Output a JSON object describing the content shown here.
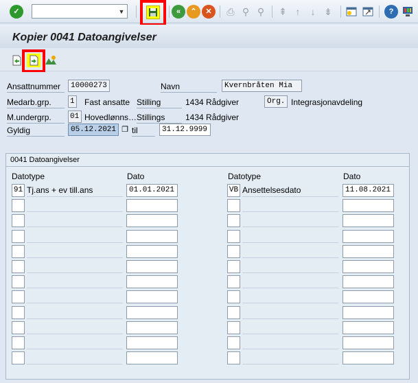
{
  "toolbar": {
    "command_value": "",
    "icons": [
      "checkmark-icon",
      "save-icon",
      "back-icon",
      "exit-icon",
      "cancel-icon",
      "print-icon",
      "find-icon",
      "find-next-icon",
      "first-page-icon",
      "prev-page-icon",
      "next-page-icon",
      "last-page-icon",
      "new-session-icon",
      "shortcut-icon",
      "help-icon",
      "layout-icon"
    ]
  },
  "title": "Kopier 0041 Datoangivelser",
  "header": {
    "ansattnummer_label": "Ansattnummer",
    "ansattnummer_value": "10000273",
    "navn_label": "Navn",
    "navn_value": "Kvernbråten Mia",
    "medarb_label": "Medarb.grp.",
    "medarb_code": "1",
    "medarb_text": "Fast ansatte",
    "stilling_label": "Stilling",
    "stilling_text": "1434 Rådgiver",
    "org_label": "Org.",
    "org_text": "Integrasjonavdeling",
    "mundergrp_label": "M.undergrp.",
    "mundergrp_code": "01",
    "mundergrp_text": "Hovedlønns…",
    "stillings_label": "Stillings",
    "stillings_text": "1434 Rådgiver",
    "gyldig_label": "Gyldig",
    "gyldig_from": "05.12.2021",
    "til_label": "til",
    "gyldig_to": "31.12.9999"
  },
  "group": {
    "title": "0041 Datoangivelser",
    "col_datotype": "Datotype",
    "col_dato": "Dato",
    "left_rows": [
      {
        "code": "91",
        "text": "Tj.ans + ev till.ans",
        "date": "01.01.2021"
      },
      {
        "code": "",
        "text": "",
        "date": ""
      },
      {
        "code": "",
        "text": "",
        "date": ""
      },
      {
        "code": "",
        "text": "",
        "date": ""
      },
      {
        "code": "",
        "text": "",
        "date": ""
      },
      {
        "code": "",
        "text": "",
        "date": ""
      },
      {
        "code": "",
        "text": "",
        "date": ""
      },
      {
        "code": "",
        "text": "",
        "date": ""
      },
      {
        "code": "",
        "text": "",
        "date": ""
      },
      {
        "code": "",
        "text": "",
        "date": ""
      },
      {
        "code": "",
        "text": "",
        "date": ""
      },
      {
        "code": "",
        "text": "",
        "date": ""
      }
    ],
    "right_rows": [
      {
        "code": "VB",
        "text": "Ansettelsesdato",
        "date": "11.08.2021"
      },
      {
        "code": "",
        "text": "",
        "date": ""
      },
      {
        "code": "",
        "text": "",
        "date": ""
      },
      {
        "code": "",
        "text": "",
        "date": ""
      },
      {
        "code": "",
        "text": "",
        "date": ""
      },
      {
        "code": "",
        "text": "",
        "date": ""
      },
      {
        "code": "",
        "text": "",
        "date": ""
      },
      {
        "code": "",
        "text": "",
        "date": ""
      },
      {
        "code": "",
        "text": "",
        "date": ""
      },
      {
        "code": "",
        "text": "",
        "date": ""
      },
      {
        "code": "",
        "text": "",
        "date": ""
      },
      {
        "code": "",
        "text": "",
        "date": ""
      }
    ]
  },
  "colors": {
    "highlight": "#ff0000",
    "save_icon_bg": "#ffff00",
    "ok_icon": "#2e9a2e",
    "cancel_icon": "#d9541e",
    "exit_icon": "#e89a20",
    "back_icon": "#3d9a3d"
  }
}
